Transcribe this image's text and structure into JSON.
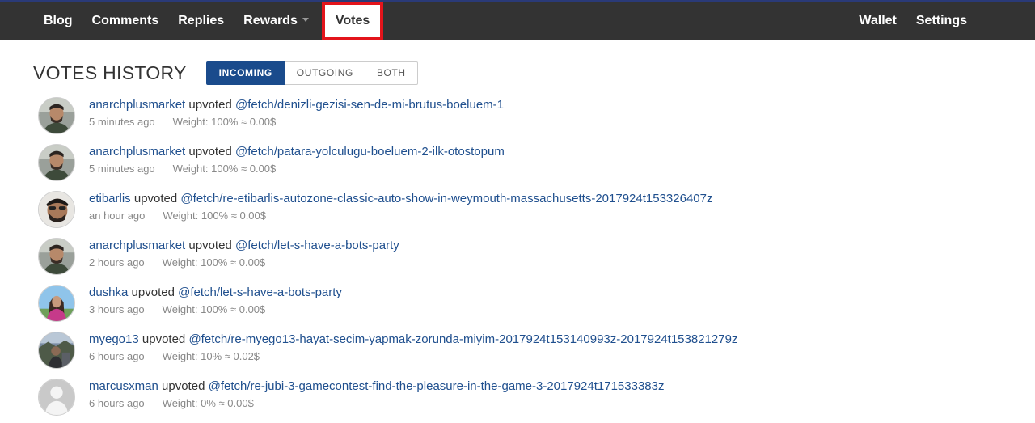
{
  "nav": {
    "left": [
      {
        "label": "Blog"
      },
      {
        "label": "Comments"
      },
      {
        "label": "Replies"
      },
      {
        "label": "Rewards"
      },
      {
        "label": "Votes"
      }
    ],
    "right": [
      {
        "label": "Wallet"
      },
      {
        "label": "Settings"
      }
    ],
    "active": "Votes",
    "highlight_color": "#e3141b"
  },
  "page": {
    "title": "VOTES HISTORY",
    "tabs": [
      {
        "label": "INCOMING"
      },
      {
        "label": "OUTGOING"
      },
      {
        "label": "BOTH"
      }
    ],
    "active_tab": "INCOMING",
    "accent_color": "#1a4b8c",
    "link_color": "#1f4f8e"
  },
  "votes": [
    {
      "voter": "anarchplusmarket",
      "action": "upvoted",
      "permlink": "@fetch/denizli-gezisi-sen-de-mi-brutus-boeluem-1",
      "time": "5 minutes ago",
      "weight": "Weight: 100% ≈ 0.00$",
      "avatar": "bearded-man"
    },
    {
      "voter": "anarchplusmarket",
      "action": "upvoted",
      "permlink": "@fetch/patara-yolculugu-boeluem-2-ilk-otostopum",
      "time": "5 minutes ago",
      "weight": "Weight: 100% ≈ 0.00$",
      "avatar": "bearded-man"
    },
    {
      "voter": "etibarlis",
      "action": "upvoted",
      "permlink": "@fetch/re-etibarlis-autozone-classic-auto-show-in-weymouth-massachusetts-2017924t153326407z",
      "time": "an hour ago",
      "weight": "Weight: 100% ≈ 0.00$",
      "avatar": "man-selfie"
    },
    {
      "voter": "anarchplusmarket",
      "action": "upvoted",
      "permlink": "@fetch/let-s-have-a-bots-party",
      "time": "2 hours ago",
      "weight": "Weight: 100% ≈ 0.00$",
      "avatar": "bearded-man"
    },
    {
      "voter": "dushka",
      "action": "upvoted",
      "permlink": "@fetch/let-s-have-a-bots-party",
      "time": "3 hours ago",
      "weight": "Weight: 100% ≈ 0.00$",
      "avatar": "woman-outdoors"
    },
    {
      "voter": "myego13",
      "action": "upvoted",
      "permlink": "@fetch/re-myego13-hayat-secim-yapmak-zorunda-miyim-2017924t153140993z-2017924t153821279z",
      "time": "6 hours ago",
      "weight": "Weight: 10% ≈ 0.02$",
      "avatar": "person-landscape"
    },
    {
      "voter": "marcusxman",
      "action": "upvoted",
      "permlink": "@fetch/re-jubi-3-gamecontest-find-the-pleasure-in-the-game-3-2017924t171533383z",
      "time": "6 hours ago",
      "weight": "Weight: 0% ≈ 0.00$",
      "avatar": "default-user"
    }
  ]
}
